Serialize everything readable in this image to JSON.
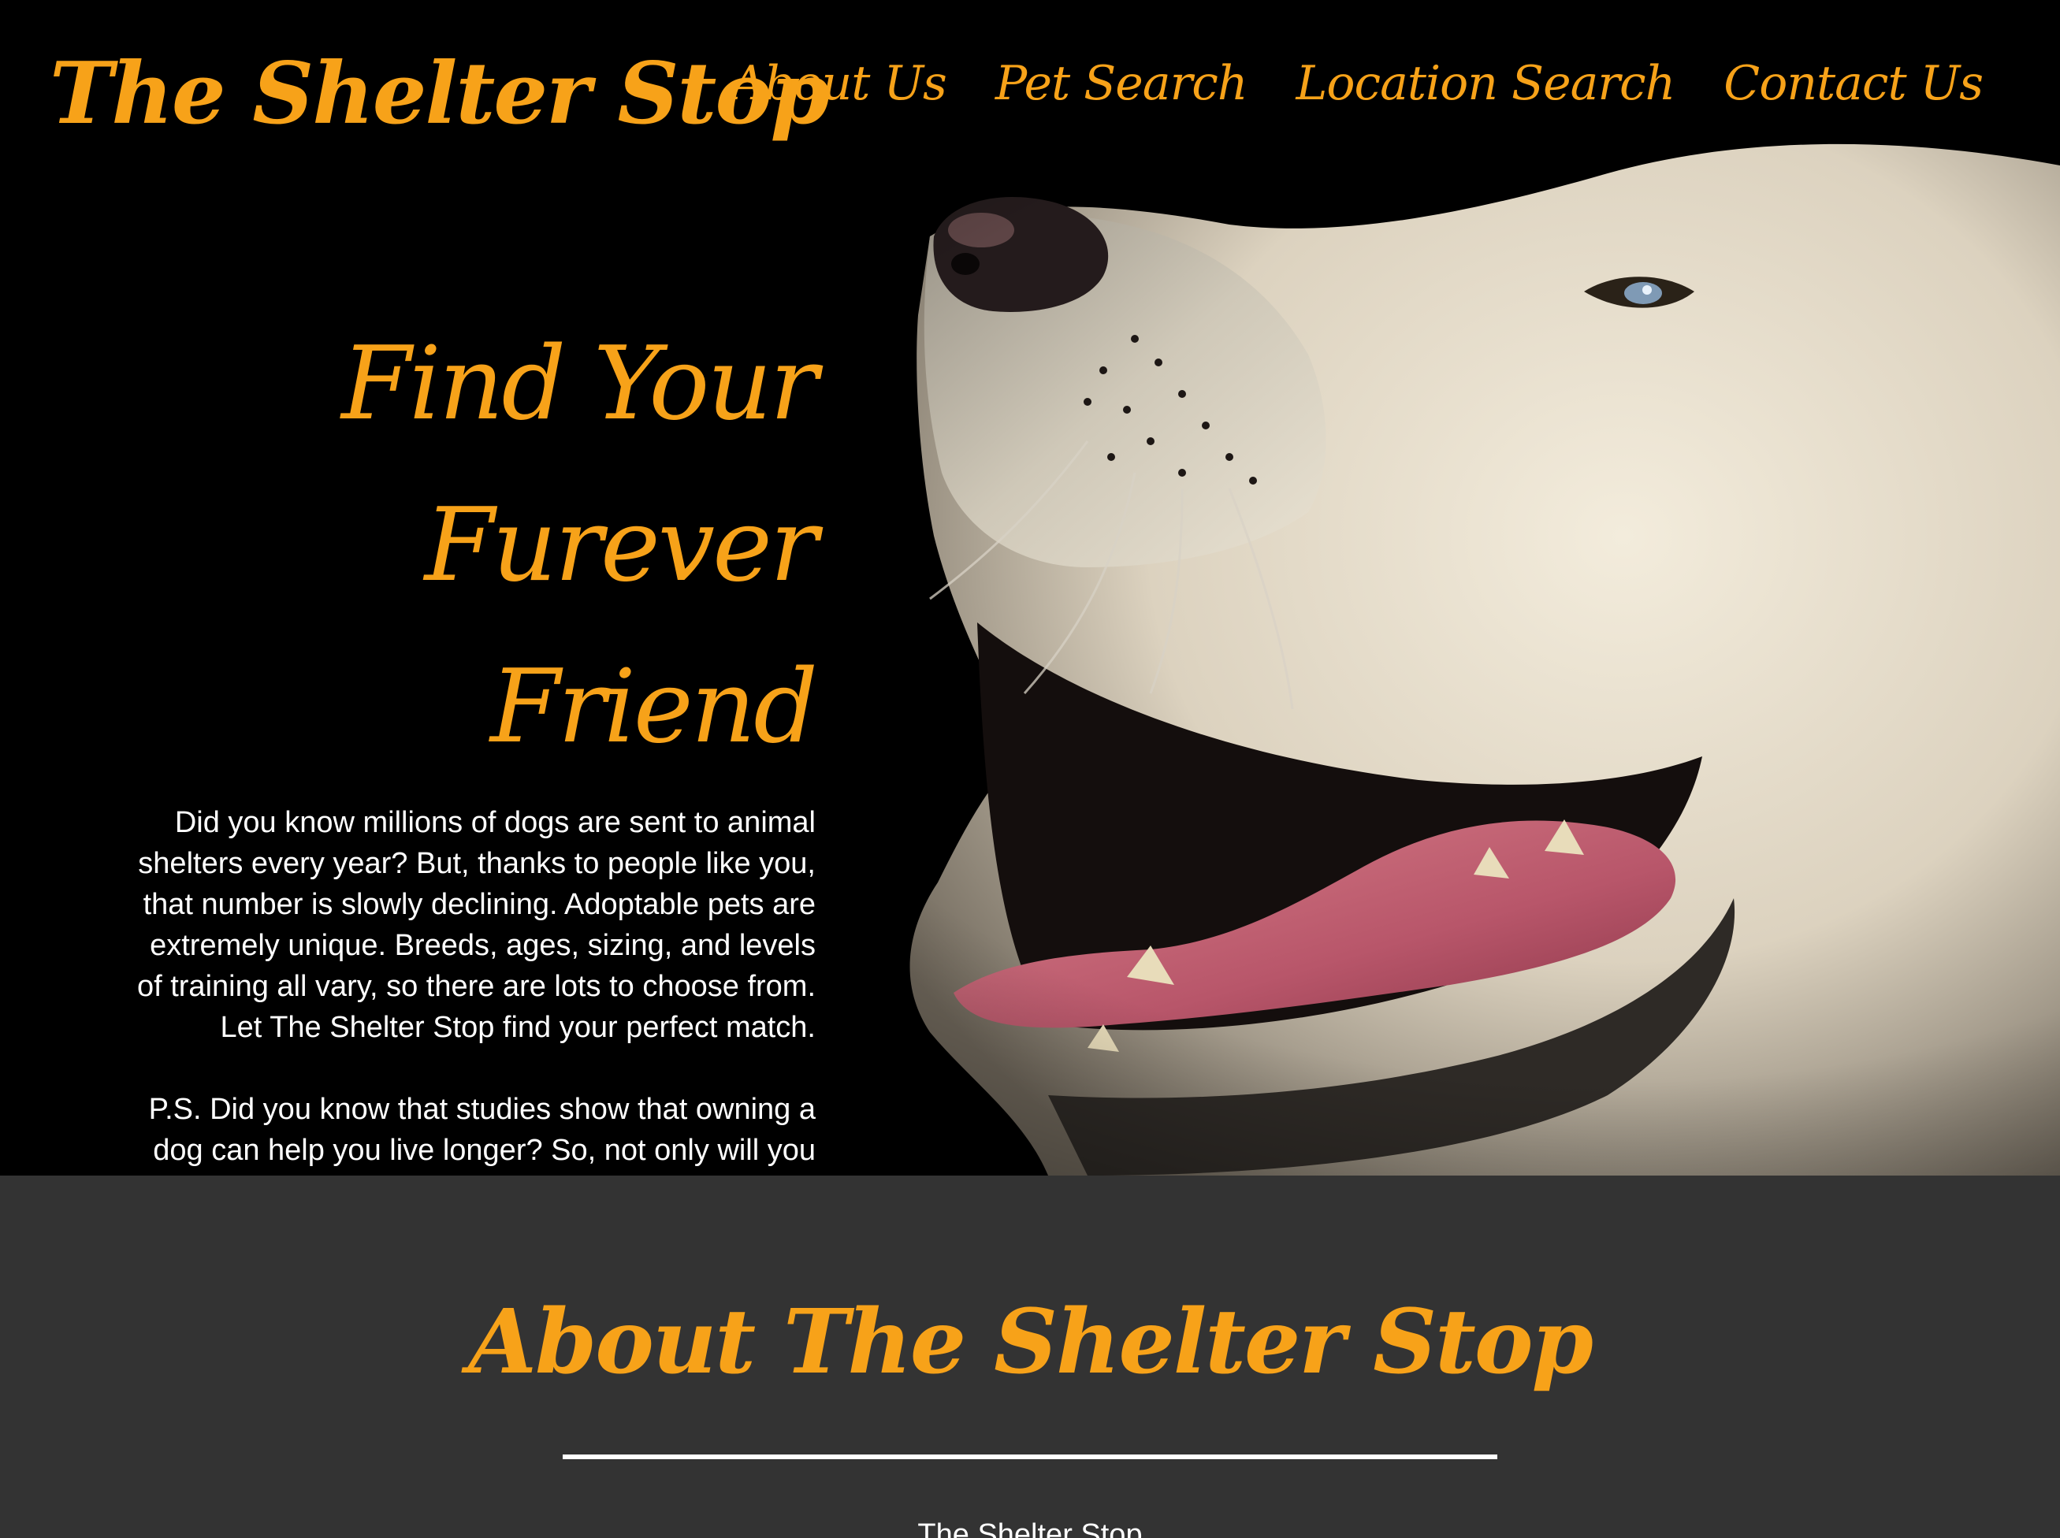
{
  "header": {
    "logo": "The Shelter Stop",
    "nav": [
      "About Us",
      "Pet Search",
      "Location Search",
      "Contact Us"
    ]
  },
  "hero": {
    "heading_line1": "Find Your",
    "heading_line2": "Furever Friend",
    "paragraph1": "Did you know millions of dogs are sent to animal shelters every year? But, thanks to people like you, that number is slowly declining. Adoptable pets are extremely unique. Breeds, ages, sizing, and levels of training all vary, so there are lots to choose from. Let The Shelter Stop find your perfect match.",
    "paragraph2": "P.S. Did you know that studies show that owning a dog can help you live longer? So, not only will you be saving a life, you'll be enhancing your own!",
    "image_subject": "dog-photo"
  },
  "about": {
    "title": "About The Shelter Stop",
    "body": "The Shelter Stop"
  },
  "colors": {
    "accent": "#f7a219",
    "hero_background": "#000000",
    "section_background": "#333333",
    "text": "#ffffff"
  }
}
